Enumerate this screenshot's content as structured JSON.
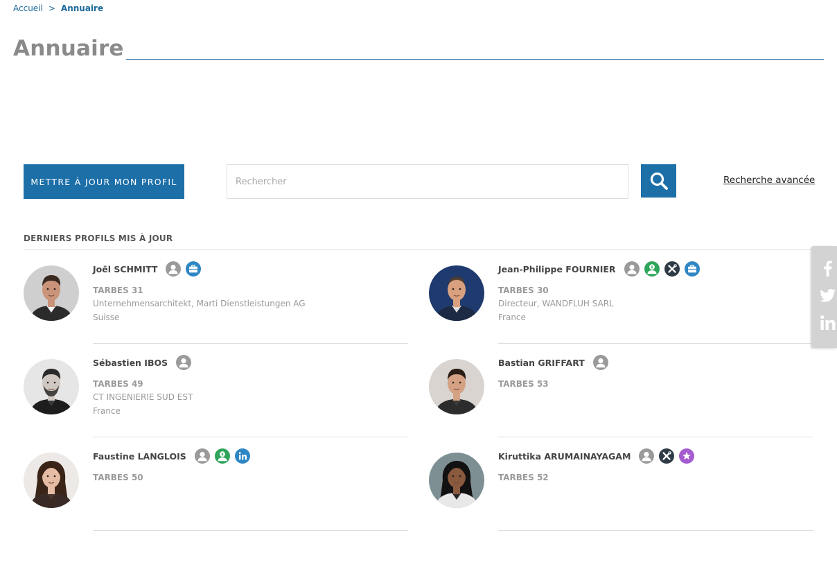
{
  "breadcrumb": {
    "home": "Accueil",
    "separator": ">",
    "current": "Annuaire"
  },
  "page": {
    "title": "Annuaire"
  },
  "toolbar": {
    "update_label": "METTRE À JOUR MON PROFIL",
    "search_placeholder": "Rechercher",
    "search_value": "",
    "advanced_label": "Recherche avancée"
  },
  "section": {
    "title": "DERNIERS PROFILS MIS À JOUR"
  },
  "profiles": [
    {
      "name": "Joël SCHMITT",
      "group": "TARBES 31",
      "line1": "Unternehmensarchitekt, Marti Dienstleistungen AG",
      "line2": "Suisse",
      "badges": [
        "user-icon",
        "briefcase-icon"
      ]
    },
    {
      "name": "Jean-Philippe FOURNIER",
      "group": "TARBES 30",
      "line1": "Directeur, WANDFLUH SARL",
      "line2": "France",
      "badges": [
        "user-icon",
        "mentor-icon",
        "tools-icon",
        "briefcase-icon"
      ]
    },
    {
      "name": "Sébastien IBOS",
      "group": "TARBES 49",
      "line1": "CT INGENIERIE SUD EST",
      "line2": "France",
      "badges": [
        "user-icon"
      ]
    },
    {
      "name": "Bastian GRIFFART",
      "group": "TARBES 53",
      "line1": "",
      "line2": "",
      "badges": [
        "user-icon"
      ]
    },
    {
      "name": "Faustine LANGLOIS",
      "group": "TARBES 50",
      "line1": "",
      "line2": "",
      "badges": [
        "user-icon",
        "mentor-icon",
        "linkedin-icon"
      ]
    },
    {
      "name": "Kiruttika ARUMAINAYAGAM",
      "group": "TARBES 52",
      "line1": "",
      "line2": "",
      "badges": [
        "user-icon",
        "tools-icon",
        "star-icon"
      ]
    }
  ],
  "share": [
    "facebook-icon",
    "twitter-icon",
    "linkedin-icon"
  ],
  "colors": {
    "primary": "#1d6fa8",
    "badge_user": "#9a9a9a",
    "badge_green": "#2ea55a",
    "badge_dark": "#2e3a45",
    "badge_blue": "#2f86c4",
    "badge_purple": "#a45bcf",
    "share_bg": "#d3d3d3"
  }
}
